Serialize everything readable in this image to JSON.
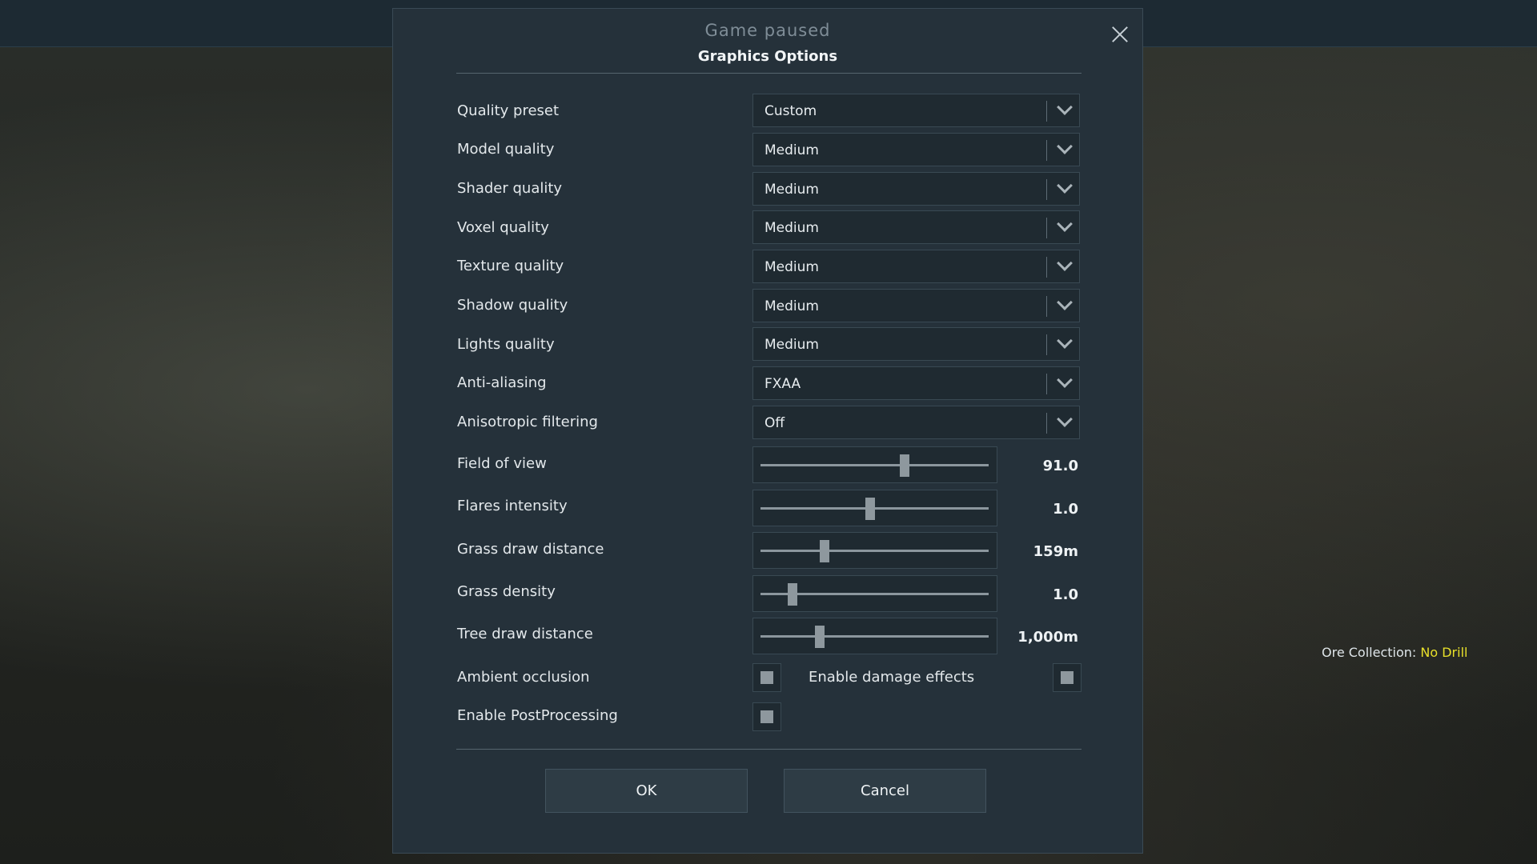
{
  "hud": {
    "ore_label": "Ore Collection:",
    "ore_value": "No Drill"
  },
  "dialog": {
    "header": "Game paused",
    "title": "Graphics Options",
    "dropdowns": [
      {
        "label": "Quality preset",
        "value": "Custom"
      },
      {
        "label": "Model quality",
        "value": "Medium"
      },
      {
        "label": "Shader quality",
        "value": "Medium"
      },
      {
        "label": "Voxel quality",
        "value": "Medium"
      },
      {
        "label": "Texture quality",
        "value": "Medium"
      },
      {
        "label": "Shadow quality",
        "value": "Medium"
      },
      {
        "label": "Lights quality",
        "value": "Medium"
      },
      {
        "label": "Anti-aliasing",
        "value": "FXAA"
      },
      {
        "label": "Anisotropic filtering",
        "value": "Off"
      }
    ],
    "sliders": [
      {
        "label": "Field of view",
        "value": "91.0",
        "level": 0.63
      },
      {
        "label": "Flares intensity",
        "value": "1.0",
        "level": 0.48
      },
      {
        "label": "Grass draw distance",
        "value": "159m",
        "level": 0.28
      },
      {
        "label": "Grass density",
        "value": "1.0",
        "level": 0.14
      },
      {
        "label": "Tree draw distance",
        "value": "1,000m",
        "level": 0.26
      }
    ],
    "checkboxes": {
      "ambient_occlusion": "Ambient occlusion",
      "damage_effects": "Enable damage effects",
      "post_processing": "Enable PostProcessing"
    },
    "buttons": {
      "ok": "OK",
      "cancel": "Cancel"
    }
  }
}
